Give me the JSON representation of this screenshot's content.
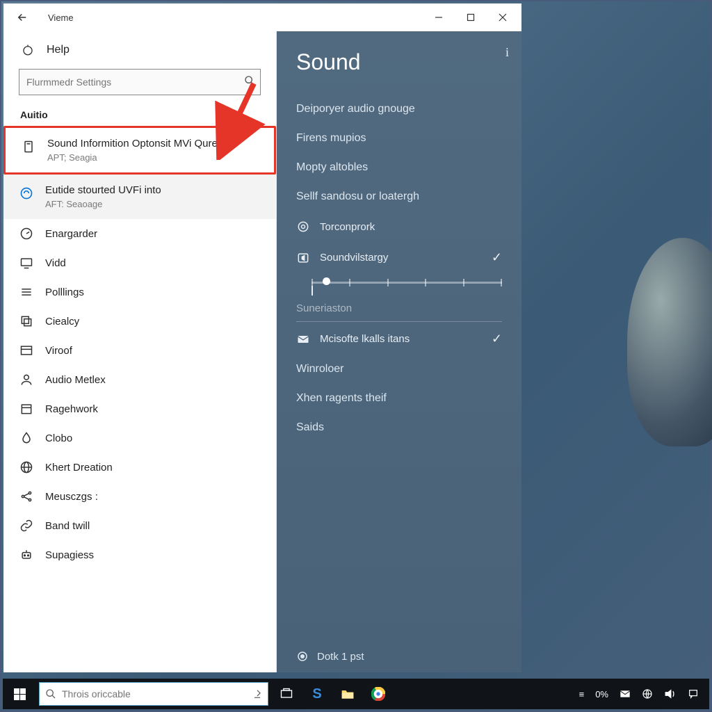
{
  "window": {
    "title": "Vieme",
    "back_aria": "Back"
  },
  "left": {
    "help_label": "Help",
    "search_placeholder": "Flurmmedr Settings",
    "section_label": "Auitio",
    "results": [
      {
        "title": "Sound Informition Optonsit MVi Qurer..",
        "sub": "APT; Seagia",
        "icon": "device-icon"
      },
      {
        "title": "Eutide stourted UVFi into",
        "sub": "AFT: Seaoage",
        "icon": "sync-icon"
      }
    ],
    "nav": [
      {
        "label": "Enargarder",
        "icon": "gauge-icon"
      },
      {
        "label": "Vidd",
        "icon": "display-icon"
      },
      {
        "label": "Polllings",
        "icon": "list-icon"
      },
      {
        "label": "Ciealcy",
        "icon": "copy-icon"
      },
      {
        "label": "Viroof",
        "icon": "panel-icon"
      },
      {
        "label": "Audio Metlex",
        "icon": "person-icon"
      },
      {
        "label": "Ragehwork",
        "icon": "calendar-icon"
      },
      {
        "label": "Clobo",
        "icon": "drop-icon"
      },
      {
        "label": "Khert Dreation",
        "icon": "globe-icon"
      },
      {
        "label": "Meusczgs :",
        "icon": "share-icon"
      },
      {
        "label": "Band twill",
        "icon": "link-icon"
      },
      {
        "label": "Supagiess",
        "icon": "robot-icon"
      }
    ]
  },
  "right": {
    "title": "Sound",
    "info_aria": "Info",
    "links": [
      "Deiporyer audio gnouge",
      "Firens mupios",
      "Mopty altobles",
      "Sellf sandosu or loatergh"
    ],
    "rows": {
      "torcon": "Torconprork",
      "soundv": "Soundvilstargy",
      "suner": "Suneriaston",
      "mic": "Mcisofte lkalls itans"
    },
    "more": [
      "Winroloer",
      "Xhen ragents theif",
      "Saids"
    ],
    "footer": "Dotk 1 pst"
  },
  "taskbar": {
    "search_placeholder": "Throis oriccable",
    "tray_text": "0%"
  }
}
